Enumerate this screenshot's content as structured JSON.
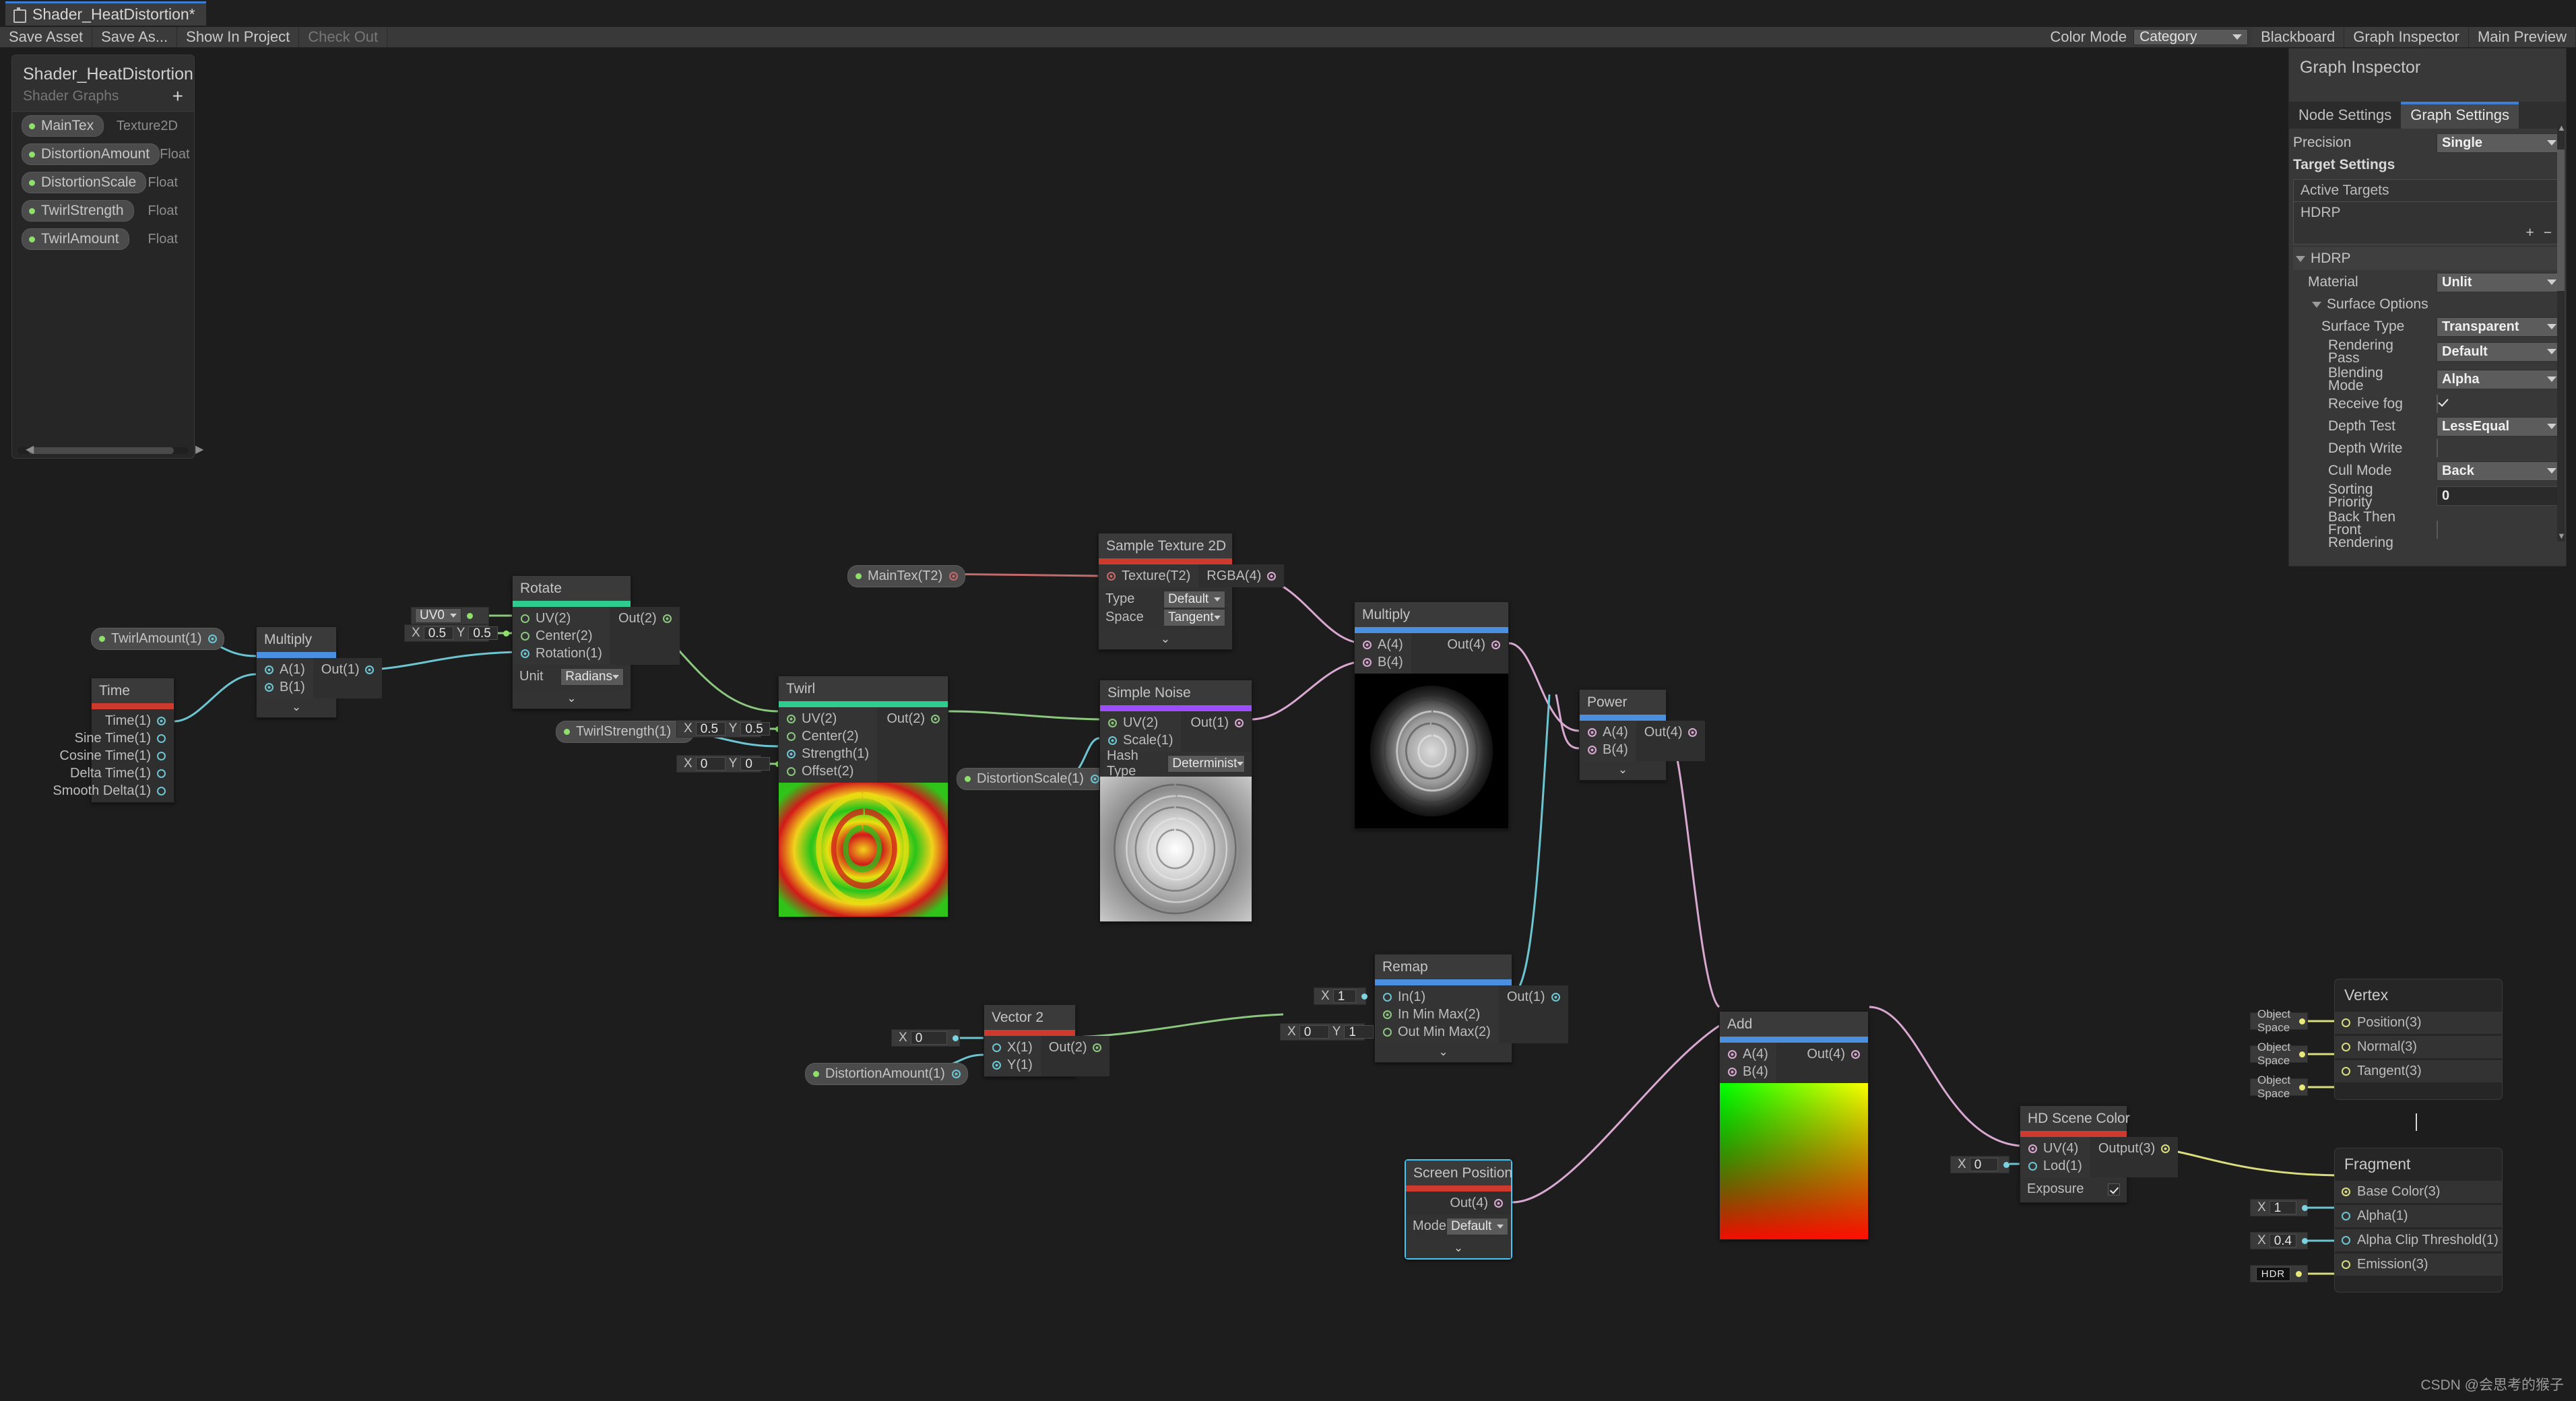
{
  "window": {
    "tab_title": "Shader_HeatDistortion*",
    "tab_icon": "shader-graph-icon"
  },
  "toolbar": {
    "buttons": [
      {
        "label": "Save Asset",
        "disabled": false
      },
      {
        "label": "Save As...",
        "disabled": false
      },
      {
        "label": "Show In Project",
        "disabled": false
      },
      {
        "label": "Check Out",
        "disabled": true
      }
    ],
    "color_mode_label": "Color Mode",
    "color_mode_value": "Category",
    "right_buttons": [
      "Blackboard",
      "Graph Inspector",
      "Main Preview"
    ]
  },
  "blackboard": {
    "title": "Shader_HeatDistortion",
    "subtitle": "Shader Graphs",
    "add_label": "+",
    "properties": [
      {
        "name": "MainTex",
        "type": "Texture2D"
      },
      {
        "name": "DistortionAmount",
        "type": "Float"
      },
      {
        "name": "DistortionScale",
        "type": "Float"
      },
      {
        "name": "TwirlStrength",
        "type": "Float"
      },
      {
        "name": "TwirlAmount",
        "type": "Float"
      }
    ]
  },
  "inspector": {
    "title": "Graph Inspector",
    "tabs": [
      {
        "label": "Node Settings",
        "active": false
      },
      {
        "label": "Graph Settings",
        "active": true
      }
    ],
    "precision_label": "Precision",
    "precision_value": "Single",
    "target_settings_label": "Target Settings",
    "active_targets_label": "Active Targets",
    "active_targets": [
      "HDRP"
    ],
    "add_target": "+",
    "remove_target": "−",
    "hdrp_label": "HDRP",
    "material_label": "Material",
    "material_value": "Unlit",
    "surface_options_label": "Surface Options",
    "rows": [
      {
        "label": "Surface Type",
        "value": "Transparent",
        "kind": "dropdown"
      },
      {
        "label": "Rendering Pass",
        "value": "Default",
        "kind": "dropdown"
      },
      {
        "label": "Blending Mode",
        "value": "Alpha",
        "kind": "dropdown"
      },
      {
        "label": "Receive fog",
        "value": "checked",
        "kind": "checkbox"
      },
      {
        "label": "Depth Test",
        "value": "LessEqual",
        "kind": "dropdown"
      },
      {
        "label": "Depth Write",
        "value": "unchecked",
        "kind": "checkbox"
      },
      {
        "label": "Cull Mode",
        "value": "Back",
        "kind": "dropdown"
      },
      {
        "label": "Sorting Priority",
        "value": "0",
        "kind": "field"
      },
      {
        "label": "Back Then Front Rendering",
        "value": "unchecked",
        "kind": "checkbox"
      }
    ]
  },
  "nodes": {
    "twirlamount_prop": {
      "label": "TwirlAmount(1)"
    },
    "twirlstrength_prop": {
      "label": "TwirlStrength(1)"
    },
    "distortionscale_prop": {
      "label": "DistortionScale(1)"
    },
    "distortionamount_prop": {
      "label": "DistortionAmount(1)"
    },
    "maintex_prop": {
      "label": "MainTex(T2)"
    },
    "time": {
      "title": "Time",
      "outputs": [
        "Time(1)",
        "Sine Time(1)",
        "Cosine Time(1)",
        "Delta Time(1)",
        "Smooth Delta(1)"
      ]
    },
    "multiply1": {
      "title": "Multiply",
      "inputs": [
        "A(1)",
        "B(1)"
      ],
      "outputs": [
        "Out(1)"
      ]
    },
    "rotate": {
      "title": "Rotate",
      "inputs": [
        "UV(2)",
        "Center(2)",
        "Rotation(1)"
      ],
      "outputs": [
        "Out(2)"
      ],
      "unit_label": "Unit",
      "unit_value": "Radians",
      "uv_value": "UV0",
      "center_x": "0.5",
      "center_y": "0.5"
    },
    "twirl": {
      "title": "Twirl",
      "inputs": [
        "UV(2)",
        "Center(2)",
        "Strength(1)",
        "Offset(2)"
      ],
      "outputs": [
        "Out(2)"
      ],
      "center_x": "0.5",
      "center_y": "0.5",
      "offset_x": "0",
      "offset_y": "0"
    },
    "sample_texture": {
      "title": "Sample Texture 2D",
      "inputs": [
        "Texture(T2)"
      ],
      "outputs": [
        "RGBA(4)"
      ],
      "type_label": "Type",
      "type_value": "Default",
      "space_label": "Space",
      "space_value": "Tangent"
    },
    "simple_noise": {
      "title": "Simple Noise",
      "inputs": [
        "UV(2)",
        "Scale(1)"
      ],
      "outputs": [
        "Out(1)"
      ],
      "hash_label": "Hash Type",
      "hash_value": "Determinist"
    },
    "multiply2": {
      "title": "Multiply",
      "inputs": [
        "A(4)",
        "B(4)"
      ],
      "outputs": [
        "Out(4)"
      ]
    },
    "power": {
      "title": "Power",
      "inputs": [
        "A(4)",
        "B(4)"
      ],
      "outputs": [
        "Out(4)"
      ]
    },
    "remap": {
      "title": "Remap",
      "inputs": [
        "In(1)",
        "In Min Max(2)",
        "Out Min Max(2)"
      ],
      "outputs": [
        "Out(1)"
      ],
      "in_x": "1",
      "outmin_x": "0",
      "outmin_y": "1"
    },
    "vector2": {
      "title": "Vector 2",
      "inputs": [
        "X(1)",
        "Y(1)"
      ],
      "outputs": [
        "Out(2)"
      ],
      "x_value": "0"
    },
    "add": {
      "title": "Add",
      "inputs": [
        "A(4)",
        "B(4)"
      ],
      "outputs": [
        "Out(4)"
      ]
    },
    "screen_position": {
      "title": "Screen Position",
      "outputs": [
        "Out(4)"
      ],
      "mode_label": "Mode",
      "mode_value": "Default"
    },
    "hd_scene_color": {
      "title": "HD Scene Color",
      "inputs": [
        "UV(4)",
        "Lod(1)"
      ],
      "outputs": [
        "Output(3)"
      ],
      "exposure_label": "Exposure",
      "exposure_checked": true,
      "lod_value": "0"
    },
    "vertex": {
      "title": "Vertex",
      "slots": [
        {
          "label": "Position(3)",
          "space": "Object Space"
        },
        {
          "label": "Normal(3)",
          "space": "Object Space"
        },
        {
          "label": "Tangent(3)",
          "space": "Object Space"
        }
      ]
    },
    "fragment": {
      "title": "Fragment",
      "slots": [
        {
          "label": "Base Color(3)",
          "value": ""
        },
        {
          "label": "Alpha(1)",
          "value": "1"
        },
        {
          "label": "Alpha Clip Threshold(1)",
          "value": "0.4"
        },
        {
          "label": "Emission(3)",
          "value": "HDR"
        }
      ]
    }
  },
  "footer": {
    "watermark": "CSDN @会思考的猴子"
  },
  "colors": {
    "accent_blue": "#4b8fe0",
    "accent_green": "#2ecc8f",
    "accent_red": "#cf3a2f",
    "accent_purple": "#9b4dff",
    "wire_cyan": "#6dc5d1",
    "wire_green": "#8cc77f",
    "wire_pink": "#d9a8d0",
    "wire_yellow": "#d9dd7e",
    "wire_red": "#c46a6a"
  }
}
